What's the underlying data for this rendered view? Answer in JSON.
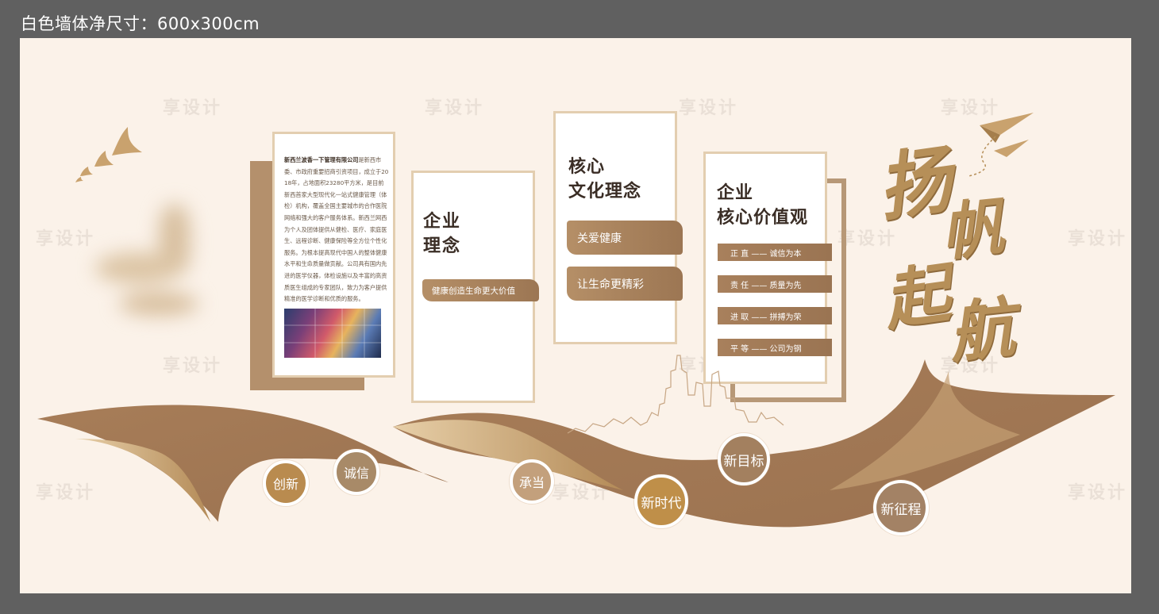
{
  "header": {
    "dimension_label": "白色墙体净尺寸：600x300cm"
  },
  "watermark": "享设计",
  "intro_panel": {
    "company_name": "新西兰波香一下管理有限公司",
    "body": "是新西市委、市政府重要招商引资项目，成立于2018年，占地面积23280平方米，是目前新西首家大型现代化一站式健康管理（体检）机构，覆盖全国主要城市的合作医院网络和强大的客户服务体系。新西兰网西为个人及团体提供从健检、医疗、家庭医生、远程诊断、健康保险等全方位个性化服务。为根本提高现代中国人的整体健康水平和生命质量做贡献。公司具有国内先进的医学仪器，体检设施以及丰富的高资质医生组成的专家团队，致力为客户提供精准的医学诊断和优质的服务。"
  },
  "enterprise_concept": {
    "title_line1": "企业",
    "title_line2": "理念",
    "tab": "健康创造生命更大价值"
  },
  "core_culture": {
    "title_line1": "核心",
    "title_line2": "文化理念",
    "tabs": [
      "关爱健康",
      "让生命更精彩"
    ]
  },
  "core_values": {
    "title_line1": "企业",
    "title_line2": "核心价值观",
    "items": [
      "正 直 —— 诚信为本",
      "责 任 —— 质量为先",
      "进 取 —— 拼搏为荣",
      "平 等 —— 公司为钢"
    ]
  },
  "slogan": {
    "chars": [
      "扬",
      "帆",
      "起",
      "航"
    ]
  },
  "milestones": [
    "创新",
    "诚信",
    "承当",
    "新时代",
    "新目标",
    "新征程"
  ],
  "colors": {
    "wall": "#fbf2e9",
    "accent": "#a67c58",
    "gold": "#b68f58",
    "frame": "#e3ceb0"
  }
}
